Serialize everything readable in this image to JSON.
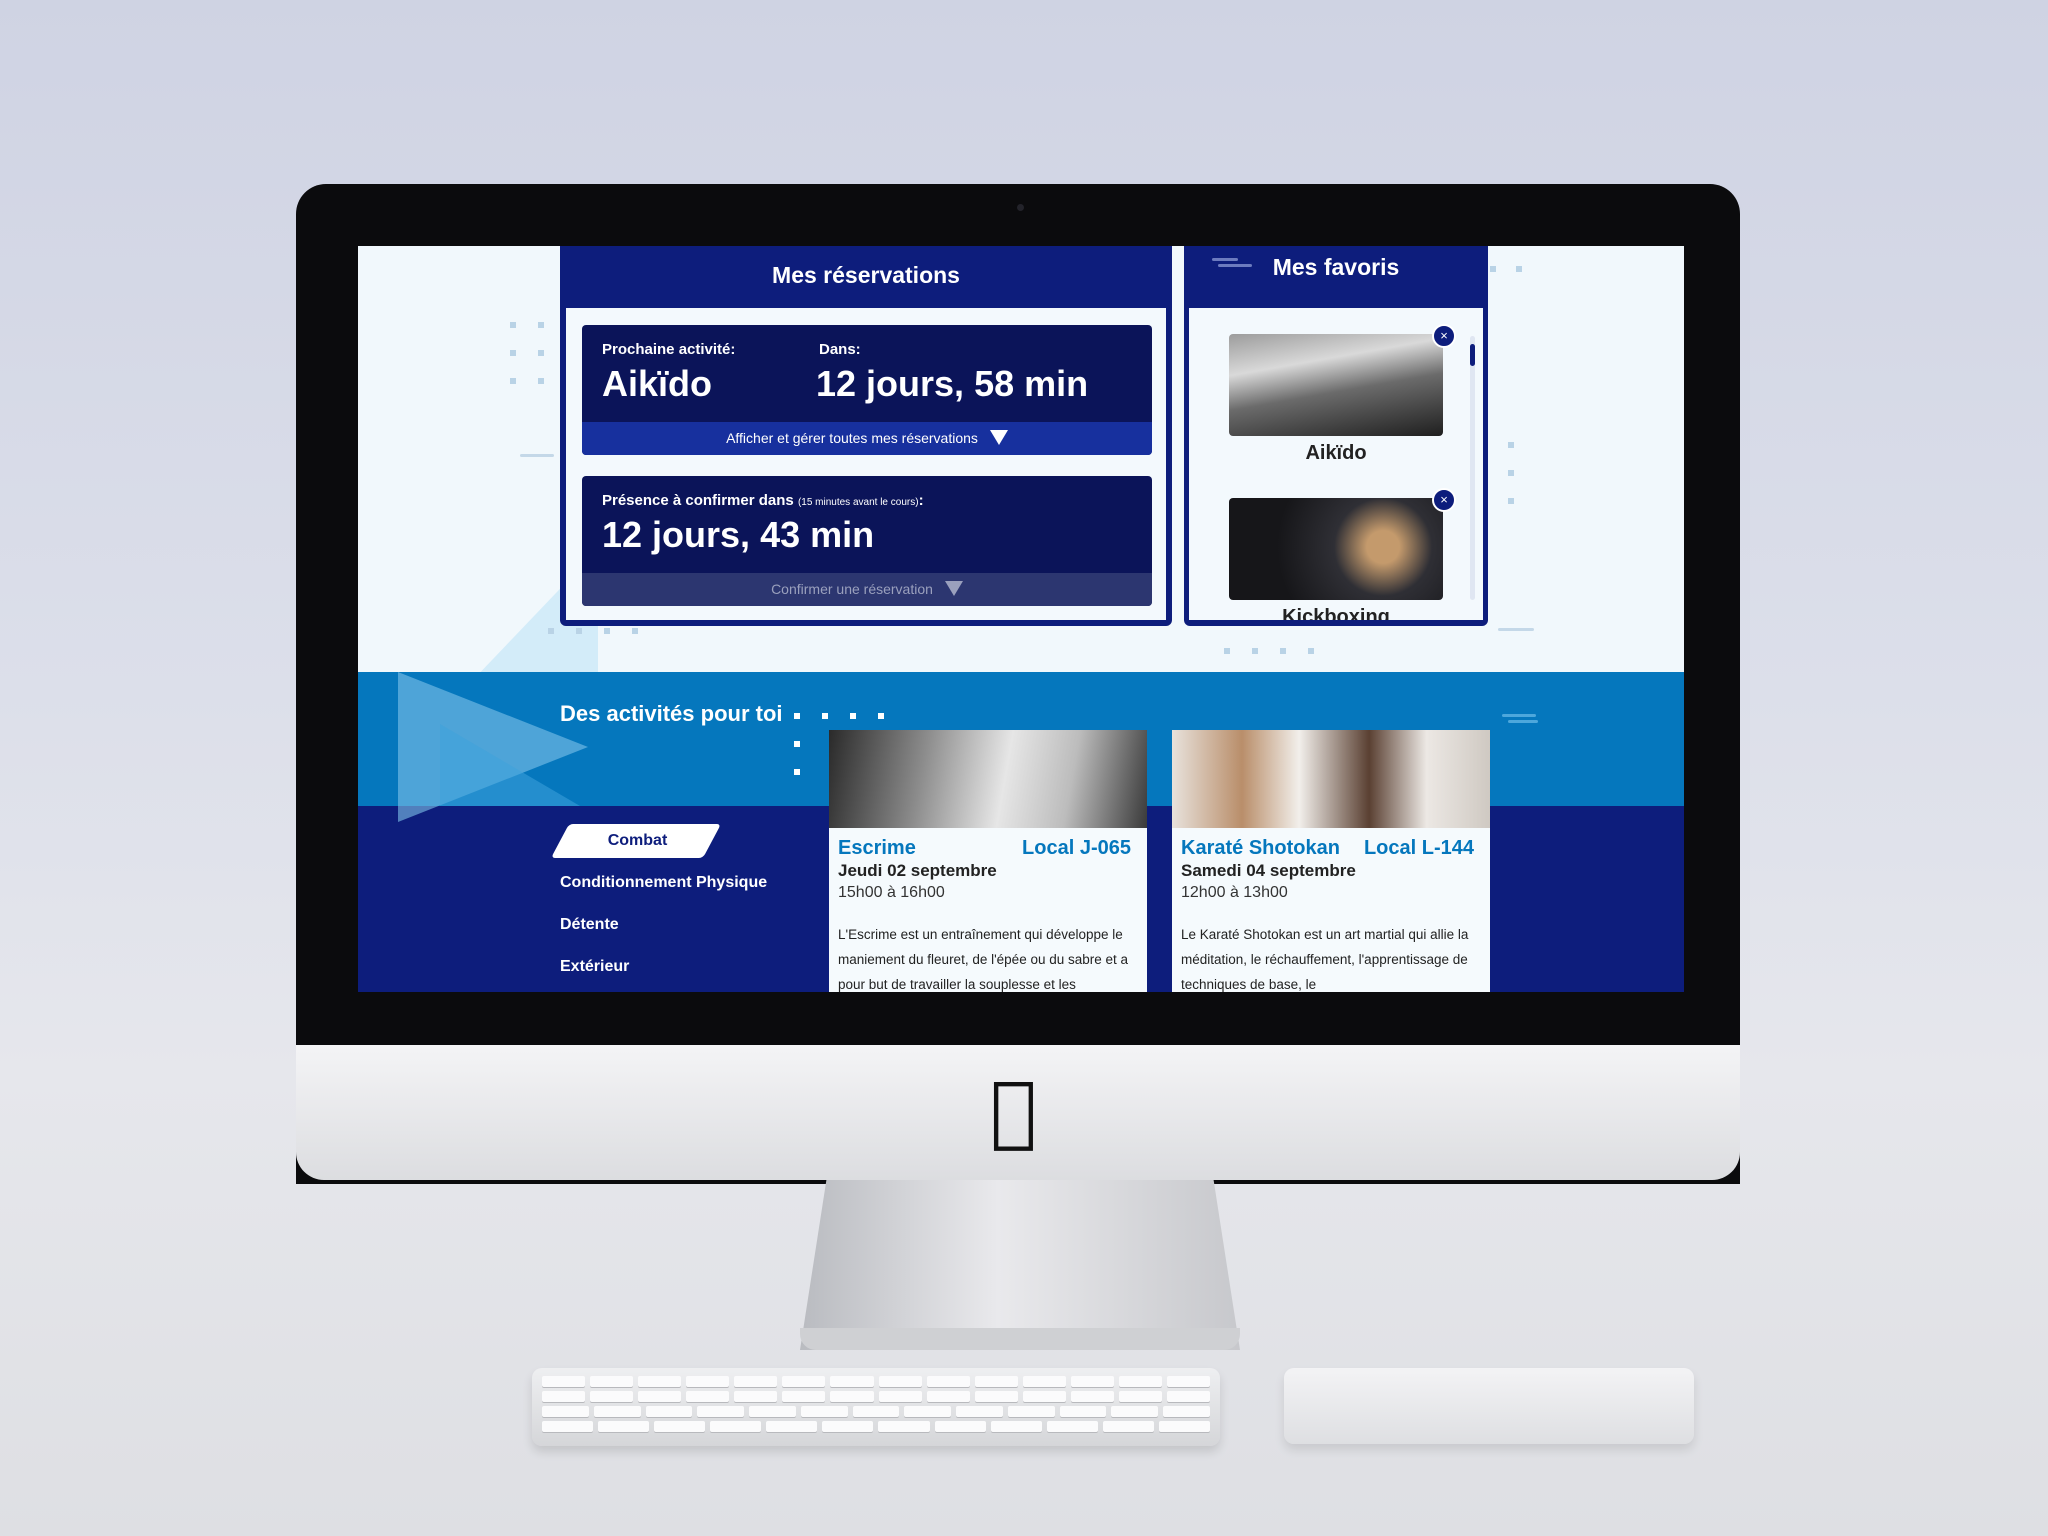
{
  "reservations": {
    "title": "Mes réservations",
    "next_label": "Prochaine activité:",
    "next_activity": "Aikïdo",
    "in_label": "Dans:",
    "in_value": "12 jours, 58 min",
    "manage_label": "Afficher et gérer toutes mes réservations",
    "presence_label": "Présence à confirmer dans",
    "presence_note": "(15 minutes avant le cours)",
    "presence_colon": ":",
    "presence_value": "12 jours, 43 min",
    "confirm_label": "Confirmer une réservation"
  },
  "favorites": {
    "title": "Mes favoris",
    "items": [
      {
        "name": "Aikïdo"
      },
      {
        "name": "Kickboxing"
      }
    ],
    "remove_symbol": "×"
  },
  "activities": {
    "title": "Des activités pour toi",
    "categories": [
      {
        "label": "Combat",
        "active": true
      },
      {
        "label": "Conditionnement Physique",
        "active": false
      },
      {
        "label": "Détente",
        "active": false
      },
      {
        "label": "Extérieur",
        "active": false
      }
    ],
    "cards": [
      {
        "name": "Escrime",
        "room": "Local J-065",
        "date": "Jeudi 02 septembre",
        "time": "15h00 à 16h00",
        "description": "L'Escrime est un entraînement qui développe le maniement du fleuret, de l'épée ou du sabre et a pour but de travailler la souplesse et les"
      },
      {
        "name": "Karaté Shotokan",
        "room": "Local L-144",
        "date": "Samedi 04 septembre",
        "time": "12h00 à 13h00",
        "description": "Le Karaté Shotokan est un art martial qui allie la méditation, le réchauffement, l'apprentissage de techniques de base, le"
      }
    ]
  },
  "colors": {
    "navy": "#0d1d7c",
    "dark_navy": "#0b1459",
    "accent_blue": "#0577bd",
    "bar_blue": "#17309e"
  },
  "icons": {
    "remove": "close-icon",
    "expand": "triangle-down-icon",
    "brand": "apple-logo"
  },
  "device": {
    "logo": ""
  }
}
